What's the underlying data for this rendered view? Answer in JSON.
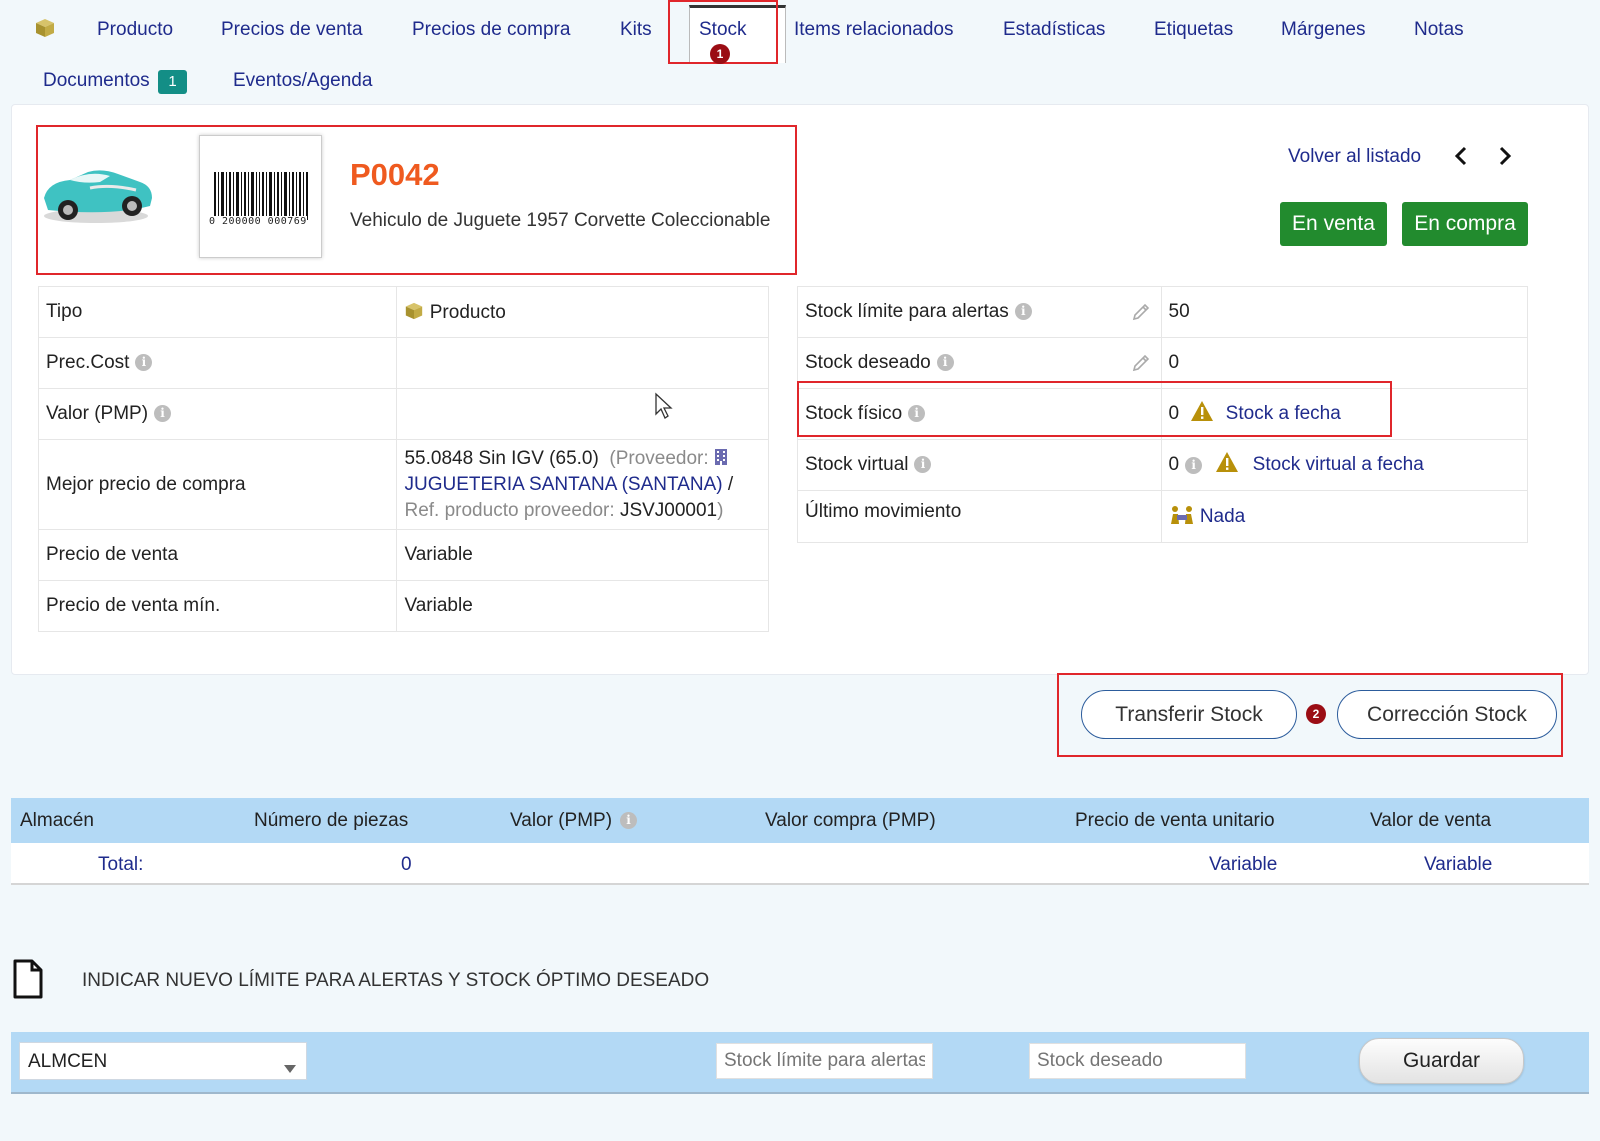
{
  "tabs": {
    "producto": "Producto",
    "precios_venta": "Precios de venta",
    "precios_compra": "Precios de compra",
    "kits": "Kits",
    "stock": "Stock",
    "items_relacionados": "Items relacionados",
    "estadisticas": "Estadísticas",
    "etiquetas": "Etiquetas",
    "margenes": "Márgenes",
    "notas": "Notas",
    "documentos": "Documentos",
    "documentos_count": "1",
    "eventos": "Eventos/Agenda"
  },
  "annotations": {
    "step1": "1",
    "step2": "2"
  },
  "product": {
    "ref": "P0042",
    "label": "Vehiculo de Juguete 1957 Corvette Coleccionable",
    "barcode_number": "0 200000 000769"
  },
  "nav": {
    "back": "Volver al listado"
  },
  "status_buttons": {
    "sale": "En venta",
    "purchase": "En compra"
  },
  "left_props": {
    "tipo_label": "Tipo",
    "tipo_value": "Producto",
    "prec_cost_label": "Prec.Cost",
    "pmp_label": "Valor (PMP)",
    "best_price_label": "Mejor precio de compra",
    "best_price_value": "55.0848 Sin IGV (65.0)",
    "proveedor_label": "(Proveedor:",
    "proveedor_name": "JUGUETERIA SANTANA (SANTANA)",
    "ref_label": "Ref. producto proveedor:",
    "ref_value": "JSVJ00001",
    "precio_venta_label": "Precio de venta",
    "precio_venta_value": "Variable",
    "precio_venta_min_label": "Precio de venta mín.",
    "precio_venta_min_value": "Variable"
  },
  "right_props": {
    "limite_label": "Stock límite para alertas",
    "limite_value": "50",
    "deseado_label": "Stock deseado",
    "deseado_value": "0",
    "fisico_label": "Stock físico",
    "fisico_value": "0",
    "fisico_link": "Stock a fecha",
    "virtual_label": "Stock virtual",
    "virtual_value": "0",
    "virtual_link": "Stock virtual a fecha",
    "ultimo_label": "Último movimiento",
    "ultimo_link": "Nada"
  },
  "actions": {
    "transfer": "Transferir Stock",
    "correction": "Corrección Stock"
  },
  "stock_table": {
    "headers": [
      "Almacén",
      "Número de piezas",
      "Valor (PMP)",
      "Valor compra (PMP)",
      "Precio de venta unitario",
      "Valor de venta"
    ],
    "total_label": "Total:",
    "total_pieces": "0",
    "total_unit_price": "Variable",
    "total_sale_value": "Variable"
  },
  "limits_section": {
    "title": "INDICAR NUEVO LÍMITE PARA ALERTAS Y STOCK ÓPTIMO DESEADO",
    "warehouse": "ALMCEN",
    "limit_placeholder": "Stock límite para alertas",
    "desired_placeholder": "Stock deseado",
    "save": "Guardar"
  },
  "colors": {
    "link": "#1f2b8c",
    "ref": "#ef5a1f",
    "green": "#228b2e",
    "header_blue": "#b3d9f5",
    "annotation_red": "#e0262b"
  }
}
